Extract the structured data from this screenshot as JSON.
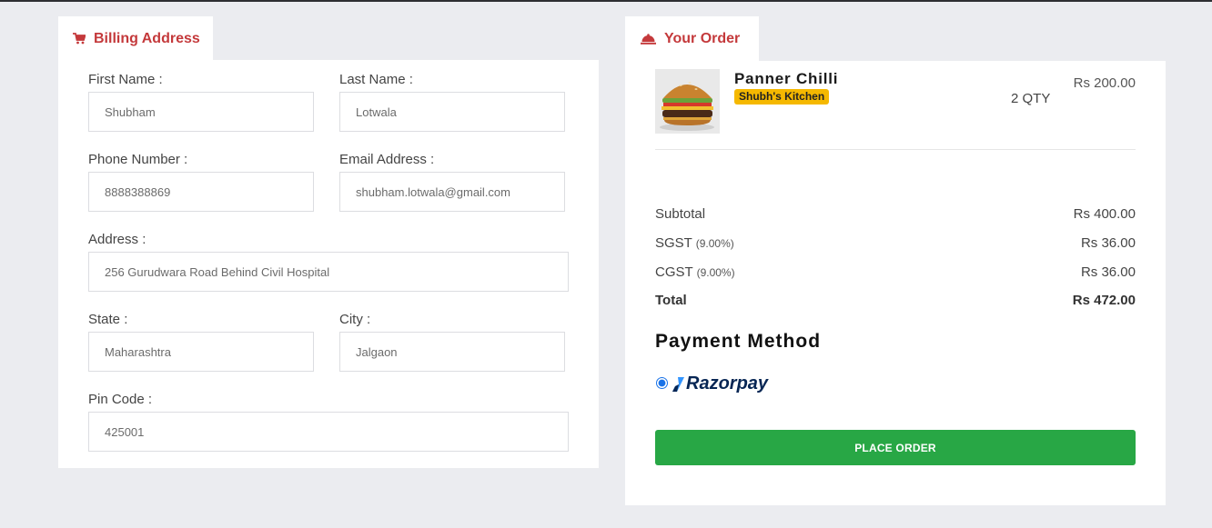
{
  "billing": {
    "title": "Billing Address",
    "icon": "cart-icon",
    "fields": {
      "first_name": {
        "label": "First Name :",
        "value": "Shubham"
      },
      "last_name": {
        "label": "Last Name :",
        "value": "Lotwala"
      },
      "phone": {
        "label": "Phone Number :",
        "value": "8888388869"
      },
      "email": {
        "label": "Email Address :",
        "value": "shubham.lotwala@gmail.com"
      },
      "address": {
        "label": "Address :",
        "value": "256 Gurudwara Road Behind Civil Hospital"
      },
      "state": {
        "label": "State :",
        "value": "Maharashtra"
      },
      "city": {
        "label": "City :",
        "value": "Jalgaon"
      },
      "pincode": {
        "label": "Pin Code :",
        "value": "425001"
      }
    }
  },
  "order": {
    "title": "Your Order",
    "icon": "food-cloche-icon",
    "item": {
      "name": "Panner Chilli",
      "vendor": "Shubh's Kitchen",
      "qty": "2 QTY",
      "price": "Rs 200.00"
    },
    "summary": {
      "subtotal_label": "Subtotal",
      "subtotal_value": "Rs 400.00",
      "sgst_label": "SGST",
      "sgst_rate": "(9.00%)",
      "sgst_value": "Rs 36.00",
      "cgst_label": "CGST",
      "cgst_rate": "(9.00%)",
      "cgst_value": "Rs 36.00",
      "total_label": "Total",
      "total_value": "Rs 472.00"
    },
    "payment": {
      "title": "Payment Method",
      "option": "Razorpay",
      "selected": true
    },
    "place_order_label": "PLACE ORDER"
  },
  "colors": {
    "accent_red": "#c4393b",
    "button_green": "#28a745",
    "badge_yellow": "#f5b800",
    "razorpay_blue": "#3395ff"
  }
}
